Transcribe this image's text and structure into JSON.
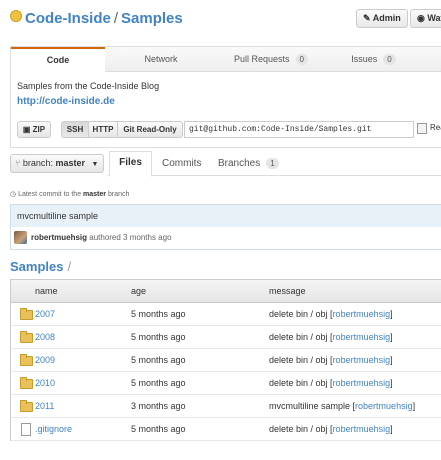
{
  "header": {
    "owner": "Code-Inside",
    "separator": "/",
    "repo": "Samples",
    "admin_label": "Admin",
    "watch_label": "Wat"
  },
  "tabs": [
    {
      "label": "Code",
      "count": null
    },
    {
      "label": "Network",
      "count": null
    },
    {
      "label": "Pull Requests",
      "count": "0"
    },
    {
      "label": "Issues",
      "count": "0"
    }
  ],
  "repo_info": {
    "description": "Samples from the Code-Inside Blog",
    "homepage": "http://code-inside.de"
  },
  "clone": {
    "zip_label": "ZIP",
    "ssh_label": "SSH",
    "http_label": "HTTP",
    "git_ro_label": "Git Read-Only",
    "url": "git@github.com:Code-Inside/Samples.git",
    "readonly_label": "Rea"
  },
  "branch": {
    "prefix": "branch:",
    "name": "master"
  },
  "subtabs": {
    "files": "Files",
    "commits": "Commits",
    "branches": "Branches",
    "branches_count": "1"
  },
  "latest_commit": {
    "label_prefix": "Latest commit to the",
    "branch": "master",
    "label_suffix": "branch",
    "message": "mvcmultiline sample",
    "author": "robertmuehsig",
    "authored": "authored 3 months ago"
  },
  "breadcrumb": {
    "repo": "Samples",
    "slash": "/"
  },
  "file_table": {
    "headers": {
      "name": "name",
      "age": "age",
      "message": "message"
    },
    "rows": [
      {
        "type": "folder",
        "name": "2007",
        "age": "5 months ago",
        "message": "delete bin / obj",
        "author": "robertmuehsig"
      },
      {
        "type": "folder",
        "name": "2008",
        "age": "5 months ago",
        "message": "delete bin / obj",
        "author": "robertmuehsig"
      },
      {
        "type": "folder",
        "name": "2009",
        "age": "5 months ago",
        "message": "delete bin / obj",
        "author": "robertmuehsig"
      },
      {
        "type": "folder",
        "name": "2010",
        "age": "5 months ago",
        "message": "delete bin / obj",
        "author": "robertmuehsig"
      },
      {
        "type": "folder",
        "name": "2011",
        "age": "3 months ago",
        "message": "mvcmultiline sample",
        "author": "robertmuehsig"
      },
      {
        "type": "file",
        "name": ".gitignore",
        "age": "5 months ago",
        "message": "delete bin / obj",
        "author": "robertmuehsig"
      }
    ]
  },
  "colors": {
    "link": "#4183c4",
    "active_tab_accent": "#d26911",
    "commit_bg": "#e9f1f8",
    "folder": "#e9c15b"
  }
}
